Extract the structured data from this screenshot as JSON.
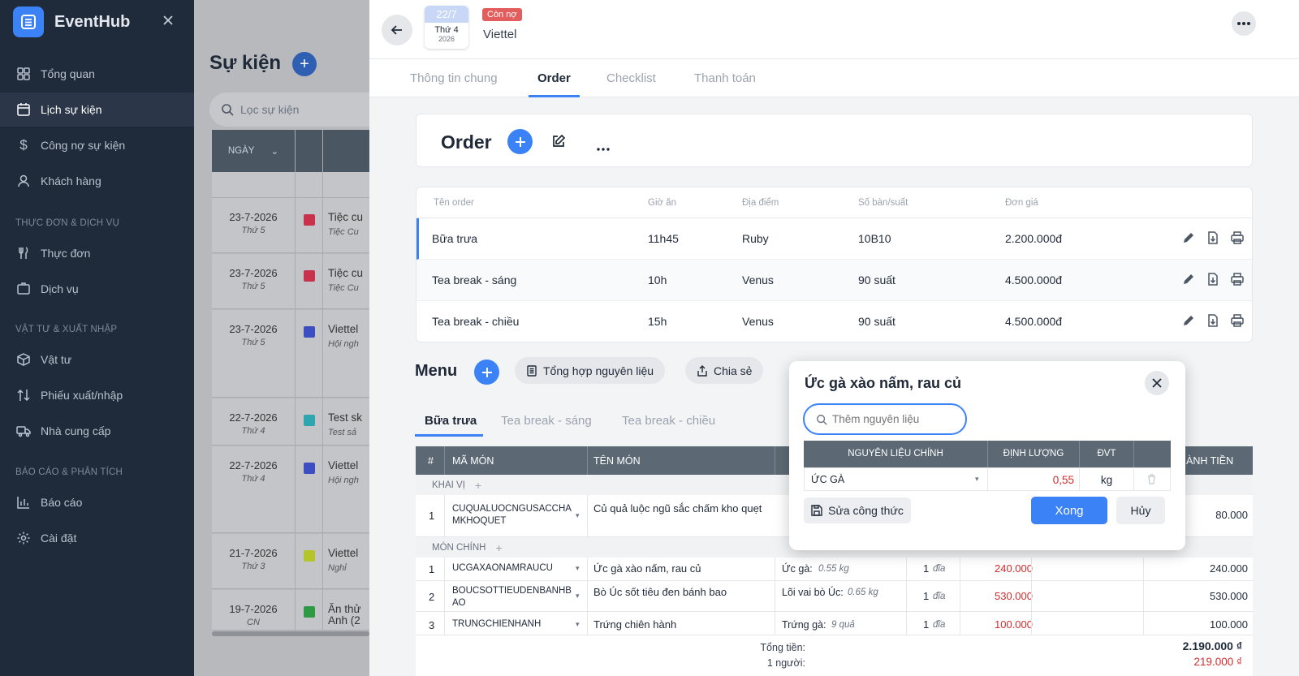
{
  "app": {
    "name": "EventHub"
  },
  "sidebar": {
    "items": [
      {
        "label": "Tổng quan",
        "icon": "dashboard-icon"
      },
      {
        "label": "Lịch sự kiện",
        "icon": "calendar-icon"
      },
      {
        "label": "Công nợ sự kiện",
        "icon": "dollar-icon"
      },
      {
        "label": "Khách hàng",
        "icon": "user-icon"
      }
    ],
    "sections": [
      {
        "title": "THỰC ĐƠN & DỊCH VỤ",
        "items": [
          {
            "label": "Thực đơn",
            "icon": "utensils-icon"
          },
          {
            "label": "Dịch vụ",
            "icon": "service-icon"
          }
        ]
      },
      {
        "title": "VẬT TƯ & XUẤT NHẬP",
        "items": [
          {
            "label": "Vật tư",
            "icon": "box-icon"
          },
          {
            "label": "Phiếu xuất/nhập",
            "icon": "transfer-icon"
          },
          {
            "label": "Nhà cung cấp",
            "icon": "truck-icon"
          }
        ]
      },
      {
        "title": "BÁO CÁO & PHÂN TÍCH",
        "items": [
          {
            "label": "Báo cáo",
            "icon": "chart-icon"
          },
          {
            "label": "Cài đặt",
            "icon": "gear-icon"
          }
        ]
      }
    ]
  },
  "events_list": {
    "title": "Sự kiện",
    "search_placeholder": "Lọc sự kiện",
    "date_header": "NGÀY",
    "rows": [
      {
        "date": "23-7-2026",
        "weekday": "Thứ 5",
        "color": "#c8324a",
        "title": "Tiệc cu",
        "subtitle": "Tiệc Cu"
      },
      {
        "date": "23-7-2026",
        "weekday": "Thứ 5",
        "color": "#c8324a",
        "title": "Tiệc cu",
        "subtitle": "Tiệc Cu"
      },
      {
        "date": "23-7-2026",
        "weekday": "Thứ 5",
        "color": "#3d4fc0",
        "title": "Viettel",
        "subtitle": "Hội ngh"
      },
      {
        "date": "22-7-2026",
        "weekday": "Thứ 4",
        "color": "#2fa5b0",
        "title": "Test sk",
        "subtitle": "Test sả"
      },
      {
        "date": "22-7-2026",
        "weekday": "Thứ 4",
        "color": "#3d4fc0",
        "title": "Viettel",
        "subtitle": "Hội ngh"
      },
      {
        "date": "21-7-2026",
        "weekday": "Thứ 3",
        "color": "#b5c42a",
        "title": "Viettel",
        "subtitle": "Nghỉ"
      },
      {
        "date": "19-7-2026",
        "weekday": "CN",
        "color": "#2e9a45",
        "title": "Ăn thử",
        "subtitle": "Anh (2"
      }
    ]
  },
  "detail": {
    "date_day": "22/7",
    "date_weekday": "Thứ 4",
    "date_year": "2026",
    "status_badge": "Còn nợ",
    "client": "Viettel",
    "tabs": [
      "Thông tin chung",
      "Order",
      "Checklist",
      "Thanh toán"
    ],
    "order_title": "Order",
    "order_columns": [
      "Tên order",
      "Giờ ăn",
      "Địa điểm",
      "Số bàn/suất",
      "Đơn giá"
    ],
    "orders": [
      {
        "name": "Bữa trưa",
        "time": "11h45",
        "place": "Ruby",
        "tables": "10B10",
        "price": "2.200.000đ"
      },
      {
        "name": "Tea break - sáng",
        "time": "10h",
        "place": "Venus",
        "tables": "90 suất",
        "price": "4.500.000đ"
      },
      {
        "name": "Tea break - chiều",
        "time": "15h",
        "place": "Venus",
        "tables": "90 suất",
        "price": "4.500.000đ"
      }
    ],
    "menu_title": "Menu",
    "menu_buttons": {
      "summary": "Tổng hợp nguyên liệu",
      "share": "Chia sẻ"
    },
    "menu_tabs": [
      "Bữa trưa",
      "Tea break - sáng",
      "Tea break - chiều"
    ],
    "menu_columns": {
      "num": "#",
      "code": "MÃ MÓN",
      "name": "TÊN MÓN",
      "total": "HÀNH TIỀN"
    },
    "groups": [
      {
        "label": "KHAI VỊ",
        "dishes": [
          {
            "num": "1",
            "code": "CUQUALUOCNGUSACCHAMKHOQUET",
            "name": "Củ quả luộc ngũ sắc chấm kho quẹt",
            "total": "80.000"
          }
        ]
      },
      {
        "label": "MÓN CHÍNH",
        "dishes": [
          {
            "num": "1",
            "code": "UCGAXAONAMRAUCU",
            "name": "Ức gà xào nấm, rau củ",
            "ingredient": "Ức gà:",
            "amount": "0.55 kg",
            "qty": "1",
            "qty_unit": "đĩa",
            "price": "240.000",
            "total": "240.000"
          },
          {
            "num": "2",
            "code": "BOUCSOTTIEUDENBANHBAO",
            "name": "Bò Úc sốt tiêu đen bánh bao",
            "ingredient": "Lõi vai bò Úc:",
            "amount": "0.65 kg",
            "qty": "1",
            "qty_unit": "đĩa",
            "price": "530.000",
            "total": "530.000"
          },
          {
            "num": "3",
            "code": "TRUNGCHIENHANH",
            "name": "Trứng chiên hành",
            "ingredient": "Trứng gà:",
            "amount": "9 quả",
            "qty": "1",
            "qty_unit": "đĩa",
            "price": "100.000",
            "total": "100.000"
          }
        ]
      }
    ],
    "totals": {
      "label_total": "Tổng tiền:",
      "value_total": "2.190.000 ₫",
      "label_per": "1 người:",
      "value_per": "219.000 ₫"
    }
  },
  "popup": {
    "title": "Ức gà xào nấm, rau củ",
    "search_placeholder": "Thêm nguyên liệu",
    "columns": [
      "NGUYÊN LIỆU CHÍNH",
      "ĐỊNH LƯỢNG",
      "ĐVT"
    ],
    "row": {
      "ingredient": "ỨC GÀ",
      "amount": "0,55",
      "unit": "kg"
    },
    "edit_recipe": "Sửa công thức",
    "done": "Xong",
    "cancel": "Hủy"
  },
  "colors": {
    "accent": "#3b82f6",
    "sidebar_bg": "#1f2a3a",
    "danger": "#d62d2d"
  }
}
